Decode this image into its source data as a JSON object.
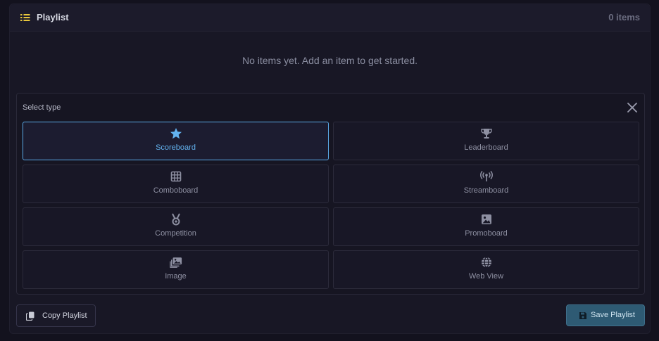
{
  "header": {
    "title": "Playlist",
    "count": "0 items",
    "icon": "list-icon",
    "icon_color": "#e8c63c"
  },
  "empty_state": "No items yet. Add an item to get started.",
  "type_selector": {
    "label": "Select type",
    "close_icon": "close-icon",
    "selected": "Scoreboard",
    "accent": "#5aa9e6",
    "types": [
      {
        "label": "Scoreboard",
        "icon": "star-icon"
      },
      {
        "label": "Leaderboard",
        "icon": "trophy-icon"
      },
      {
        "label": "Comboboard",
        "icon": "grid-icon"
      },
      {
        "label": "Streamboard",
        "icon": "broadcast-icon"
      },
      {
        "label": "Competition",
        "icon": "medal-icon"
      },
      {
        "label": "Promoboard",
        "icon": "image-icon"
      },
      {
        "label": "Image",
        "icon": "images-icon"
      },
      {
        "label": "Web View",
        "icon": "globe-icon"
      }
    ]
  },
  "footer": {
    "copy_label": "Copy Playlist",
    "save_label": "Save Playlist"
  }
}
